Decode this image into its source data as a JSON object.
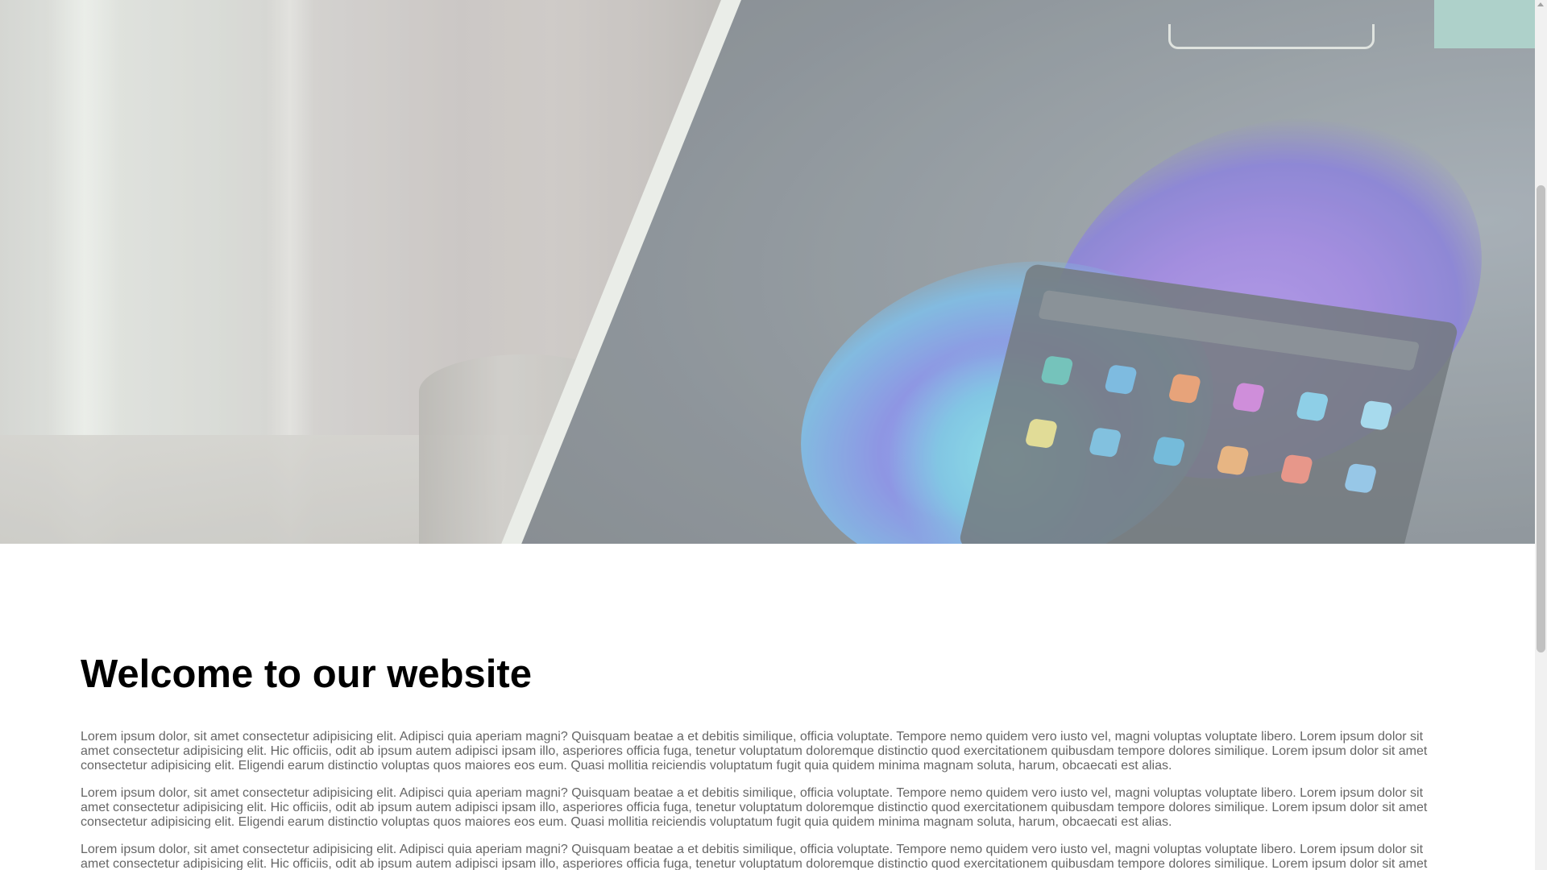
{
  "main": {
    "heading": "Welcome to our website",
    "paragraphs": [
      "Lorem ipsum dolor, sit amet consectetur adipisicing elit. Adipisci quia aperiam magni? Quisquam beatae a et debitis similique, officia voluptate. Tempore nemo quidem vero iusto vel, magni voluptas voluptate libero. Lorem ipsum dolor sit amet consectetur adipisicing elit. Hic officiis, odit ab ipsum autem adipisci ipsam illo, asperiores officia fuga, tenetur voluptatum doloremque distinctio quod exercitationem quibusdam tempore dolores similique. Lorem ipsum dolor sit amet consectetur adipisicing elit. Eligendi earum distinctio voluptas quos maiores eos eum. Quasi mollitia reiciendis voluptatum fugit quia quidem minima magnam soluta, harum, obcaecati est alias.",
      "Lorem ipsum dolor, sit amet consectetur adipisicing elit. Adipisci quia aperiam magni? Quisquam beatae a et debitis similique, officia voluptate. Tempore nemo quidem vero iusto vel, magni voluptas voluptate libero. Lorem ipsum dolor sit amet consectetur adipisicing elit. Hic officiis, odit ab ipsum autem adipisci ipsam illo, asperiores officia fuga, tenetur voluptatum doloremque distinctio quod exercitationem quibusdam tempore dolores similique. Lorem ipsum dolor sit amet consectetur adipisicing elit. Eligendi earum distinctio voluptas quos maiores eos eum. Quasi mollitia reiciendis voluptatum fugit quia quidem minima magnam soluta, harum, obcaecati est alias.",
      "Lorem ipsum dolor, sit amet consectetur adipisicing elit. Adipisci quia aperiam magni? Quisquam beatae a et debitis similique, officia voluptate. Tempore nemo quidem vero iusto vel, magni voluptas voluptate libero. Lorem ipsum dolor sit amet consectetur adipisicing elit. Hic officiis, odit ab ipsum autem adipisci ipsam illo, asperiores officia fuga, tenetur voluptatum doloremque distinctio quod exercitationem quibusdam tempore dolores similique. Lorem ipsum dolor sit amet consectetur adipisicing elit. Eligendi earum distinctio voluptas quos maiores eos eum. Quasi mollitia reiciendis voluptatum fugit quia quidem minima magnam soluta, harum, obcaecati est alias."
    ]
  },
  "colors": {
    "heading": "#000000",
    "body_text": "#666666",
    "page_background": "#ffffff",
    "scrollbar_track": "#f1f1f1",
    "scrollbar_thumb": "#c1c1c1"
  },
  "hero": {
    "icon": "laptop-photo"
  }
}
